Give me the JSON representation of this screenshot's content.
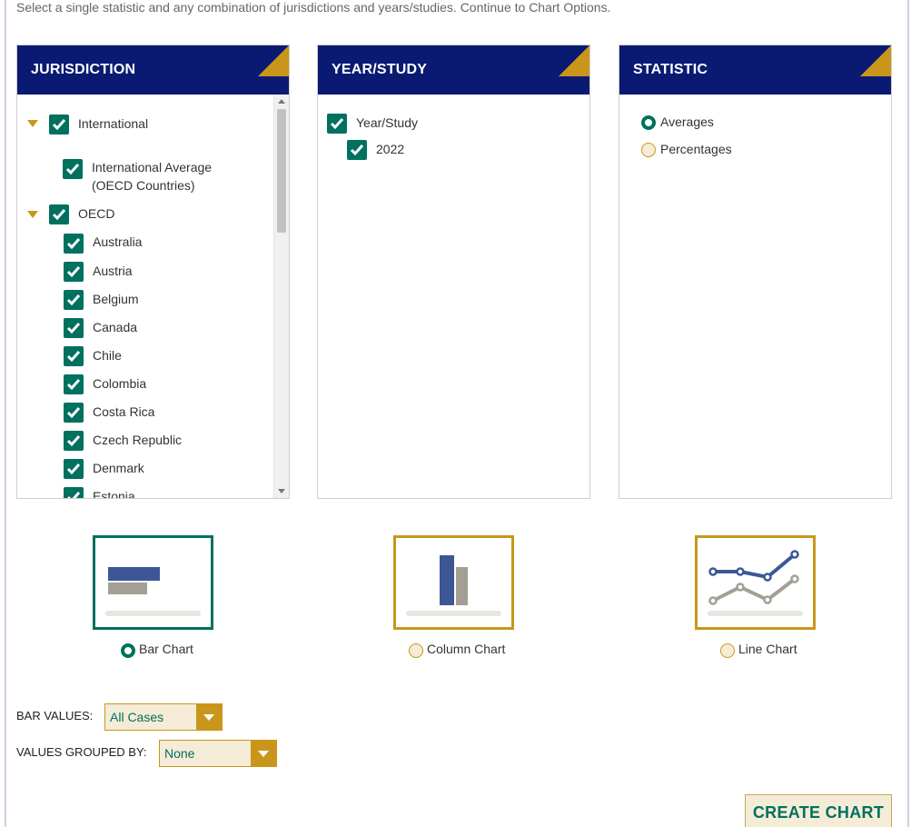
{
  "instructions": "Select a single statistic and any combination of jurisdictions and years/studies. Continue to Chart Options.",
  "colors": {
    "header_navy": "#0a1a73",
    "accent_gold": "#c9961b",
    "teal": "#00705f",
    "cream": "#f5ecd7"
  },
  "jurisdiction": {
    "title": "JURISDICTION",
    "groups": {
      "international": {
        "label": "International",
        "expanded": true,
        "checked": true
      },
      "international_average": {
        "label_line1": "International Average",
        "label_line2": "(OECD Countries)",
        "checked": true
      },
      "oecd": {
        "label": "OECD",
        "expanded": true,
        "checked": true
      }
    },
    "countries": [
      "Australia",
      "Austria",
      "Belgium",
      "Canada",
      "Chile",
      "Colombia",
      "Costa Rica",
      "Czech Republic",
      "Denmark",
      "Estonia"
    ]
  },
  "year_study": {
    "title": "YEAR/STUDY",
    "group_label": "Year/Study",
    "year": "2022"
  },
  "statistic": {
    "title": "STATISTIC",
    "options": [
      "Averages",
      "Percentages"
    ],
    "selected": "Averages"
  },
  "chart_types": {
    "options": [
      "Bar Chart",
      "Column Chart",
      "Line Chart"
    ],
    "selected": "Bar Chart"
  },
  "bar_values": {
    "label": "BAR VALUES:",
    "value": "All Cases"
  },
  "grouped_by": {
    "label": "VALUES GROUPED BY:",
    "value": "None"
  },
  "create_button": "CREATE CHART"
}
